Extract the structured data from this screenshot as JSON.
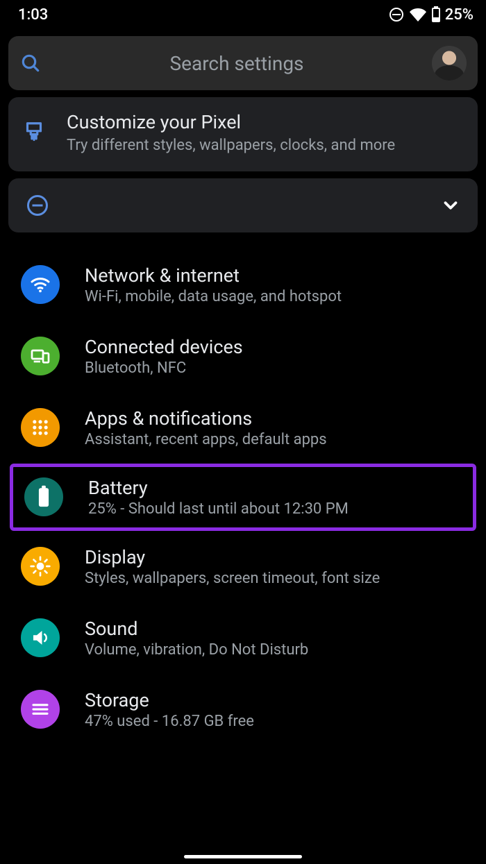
{
  "status": {
    "time": "1:03",
    "battery_text": "25%"
  },
  "search": {
    "placeholder": "Search settings"
  },
  "customize": {
    "title": "Customize your Pixel",
    "subtitle": "Try different styles, wallpapers, clocks, and more"
  },
  "items": [
    {
      "title": "Network & internet",
      "subtitle": "Wi-Fi, mobile, data usage, and hotspot"
    },
    {
      "title": "Connected devices",
      "subtitle": "Bluetooth, NFC"
    },
    {
      "title": "Apps & notifications",
      "subtitle": "Assistant, recent apps, default apps"
    },
    {
      "title": "Battery",
      "subtitle": "25% - Should last until about 12:30 PM"
    },
    {
      "title": "Display",
      "subtitle": "Styles, wallpapers, screen timeout, font size"
    },
    {
      "title": "Sound",
      "subtitle": "Volume, vibration, Do Not Disturb"
    },
    {
      "title": "Storage",
      "subtitle": "47% used - 16.87 GB free"
    }
  ]
}
